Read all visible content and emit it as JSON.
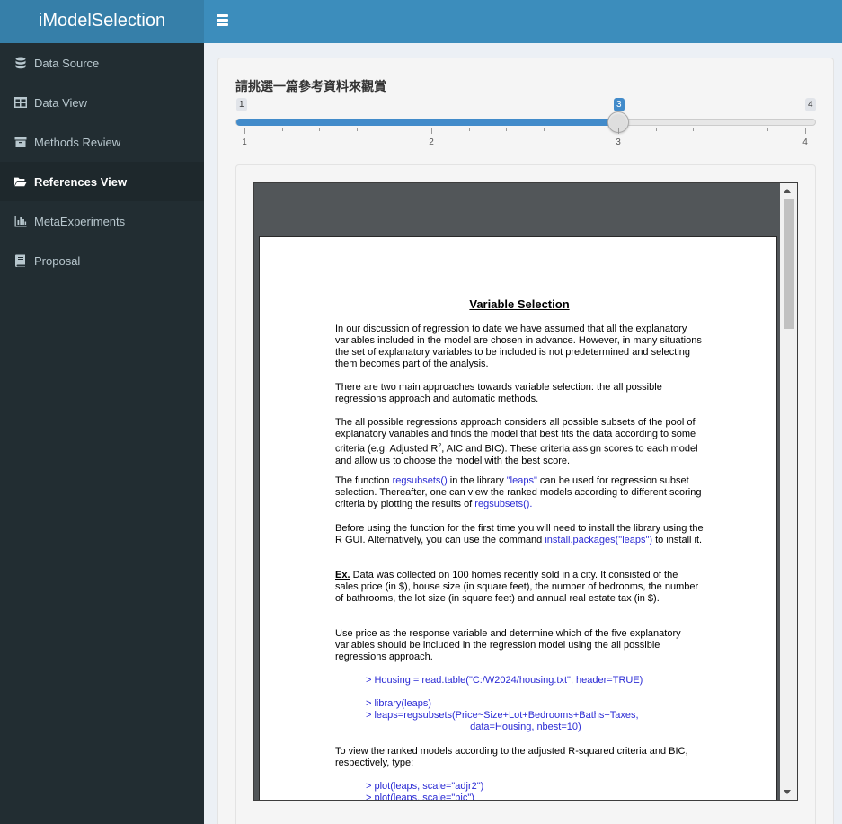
{
  "app": {
    "title": "iModelSelection"
  },
  "sidebar": {
    "items": [
      {
        "label": "Data Source",
        "icon": "database-icon"
      },
      {
        "label": "Data View",
        "icon": "table-icon"
      },
      {
        "label": "Methods Review",
        "icon": "archive-icon"
      },
      {
        "label": "References View",
        "icon": "folder-open-icon",
        "active": true
      },
      {
        "label": "MetaExperiments",
        "icon": "bar-chart-icon"
      },
      {
        "label": "Proposal",
        "icon": "book-icon"
      }
    ]
  },
  "slider": {
    "label": "請挑選一篇參考資料來觀賞",
    "min": 1,
    "max": 4,
    "value": 3,
    "min_label": "1",
    "max_label": "4",
    "value_label": "3",
    "ticks": [
      "1",
      "2",
      "3",
      "4"
    ]
  },
  "document": {
    "title": "Variable Selection",
    "p1": "In our discussion of regression to date we have assumed that all the explanatory variables included in the model are chosen in advance. However, in many situations the set of explanatory variables to be included is not predetermined and selecting them becomes part of the analysis.",
    "p2": "There are two main approaches towards variable selection: the all possible regressions approach and automatic methods.",
    "p3_a": "The all possible regressions approach considers all possible subsets of the pool of explanatory variables and finds the model that best fits the data according to some criteria (e.g. Adjusted R",
    "p3_sup": "2",
    "p3_b": ", AIC and BIC). These criteria assign scores to each model and allow us to choose the model with the best score.",
    "p4_a": "The function ",
    "p4_fn": "regsubsets()",
    "p4_b": " in the library ",
    "p4_lib": "\"leaps\"",
    "p4_c": " can be used for regression subset selection. Thereafter, one can view the ranked models according to different scoring criteria by plotting the results of ",
    "p4_fn2": "regsubsets().",
    "p5_a": "Before using the function for the first time you will need to install the library using the R GUI. Alternatively, you can use the command ",
    "p5_cmd": "install.packages(\"leaps\")",
    "p5_b": " to install it.",
    "p6_ex": "Ex.",
    "p6": " Data was collected on 100 homes recently sold in a city. It consisted of the sales price (in $), house size (in square feet), the number of bedrooms, the number of bathrooms, the lot size (in square feet) and annual real estate tax (in $).",
    "p7": "Use price as the response variable and determine which of the five explanatory variables should be included in the regression model using the all possible regressions approach.",
    "code1": "> Housing = read.table(\"C:/W2024/housing.txt\", header=TRUE)",
    "code2": "> library(leaps)",
    "code3": "> leaps=regsubsets(Price~Size+Lot+Bedrooms+Baths+Taxes,",
    "code4": "                                      data=Housing, nbest=10)",
    "p8": "To view the ranked models according to the adjusted R-squared criteria and BIC, respectively, type:",
    "code5": "> plot(leaps, scale=\"adjr2\")",
    "code6": "> plot(leaps, scale=\"bic\")"
  },
  "colors": {
    "header": "#3c8dbc",
    "logo": "#367fa9",
    "sidebar": "#222d32",
    "accent": "#428bca"
  }
}
